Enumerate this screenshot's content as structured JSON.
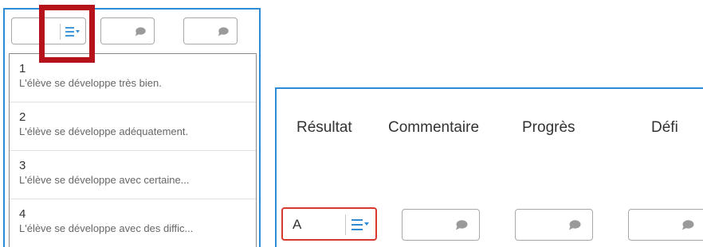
{
  "dropdown": {
    "options": [
      {
        "num": "1",
        "desc": "L'élève se développe très bien."
      },
      {
        "num": "2",
        "desc": "L'élève se développe adéquatement."
      },
      {
        "num": "3",
        "desc": "L'élève se développe avec certaine..."
      },
      {
        "num": "4",
        "desc": "L'élève se développe avec des diffic..."
      }
    ]
  },
  "table": {
    "headers": {
      "result": "Résultat",
      "comment": "Commentaire",
      "progress": "Progrès",
      "challenge": "Défi"
    },
    "result_value": "A"
  },
  "icons": {
    "menu": "list-dropdown-icon",
    "comment": "speech-bubble-icon"
  },
  "colors": {
    "accent_blue": "#2e8bd6",
    "highlight_red": "#b5121b",
    "error_red": "#d63a2f",
    "icon_gray": "#9a9a9a"
  }
}
